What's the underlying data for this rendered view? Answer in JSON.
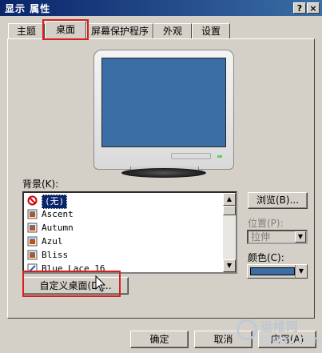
{
  "window": {
    "title": "显示 属性",
    "help_btn": "?",
    "close_btn": "×"
  },
  "tabs": [
    {
      "label": "主题"
    },
    {
      "label": "桌面"
    },
    {
      "label": "屏幕保护程序"
    },
    {
      "label": "外观"
    },
    {
      "label": "设置"
    }
  ],
  "background": {
    "label": "背景(K):",
    "items": [
      {
        "label": "(无)",
        "icon": "none-icon"
      },
      {
        "label": "Ascent",
        "icon": "image-file-icon"
      },
      {
        "label": "Autumn",
        "icon": "image-file-icon"
      },
      {
        "label": "Azul",
        "icon": "image-file-icon"
      },
      {
        "label": "Bliss",
        "icon": "image-file-icon"
      },
      {
        "label": "Blue Lace 16",
        "icon": "bitmap-file-icon"
      }
    ],
    "selected": "(无)"
  },
  "buttons": {
    "browse": "浏览(B)...",
    "customize": "自定义桌面(D)...",
    "ok": "确定",
    "cancel": "取消",
    "apply": "应用(A)"
  },
  "position": {
    "label": "位置(P):",
    "value": "拉伸"
  },
  "color": {
    "label": "颜色(C):",
    "value": "#3a6ea5"
  },
  "watermark": {
    "top": "运维网",
    "bottom": "iyunv.com"
  }
}
